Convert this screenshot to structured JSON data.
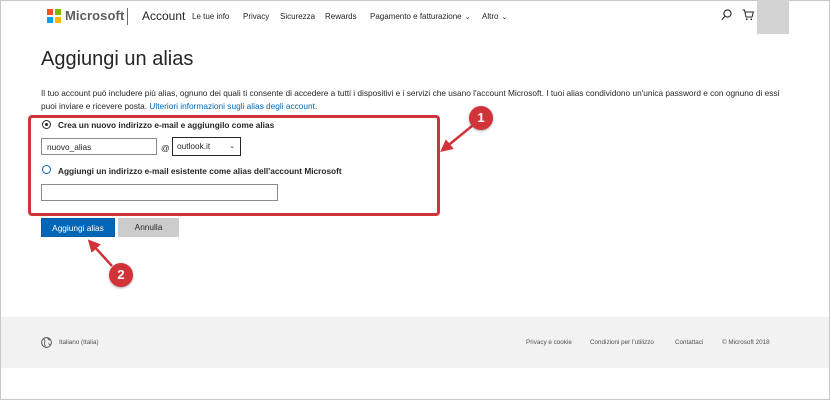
{
  "header": {
    "brand": "Microsoft",
    "section": "Account",
    "nav": [
      {
        "label": "Le tue info"
      },
      {
        "label": "Privacy"
      },
      {
        "label": "Sicurezza"
      },
      {
        "label": "Rewards"
      },
      {
        "label": "Pagamento e fatturazione"
      },
      {
        "label": "Altro"
      }
    ],
    "icons": [
      "search-icon",
      "cart-icon",
      "chevron-down-icon"
    ]
  },
  "page": {
    "title": "Aggiungi un alias",
    "description": "Il tuo account può includere più alias, ognuno dei quali ti consente di accedere a tutti i dispositivi e i servizi che usano l'account Microsoft. I tuoi alias condividono un'unica password e con ognuno di essi puoi inviare e ricevere posta. ",
    "learn_more_link": "Ulteriori informazioni sugli alias degli account."
  },
  "form": {
    "option_new_label": "Crea un nuovo indirizzo e-mail e aggiungilo come alias",
    "option_new_selected": true,
    "alias_value": "nuovo_alias",
    "at_symbol": "@",
    "domain_selected": "outlook.it",
    "option_existing_label": "Aggiungi un indirizzo e-mail esistente come alias dell'account Microsoft",
    "option_existing_selected": false,
    "existing_value": ""
  },
  "buttons": {
    "add_alias": "Aggiungi alias",
    "cancel": "Annulla"
  },
  "annotations": {
    "badge_1": "1",
    "badge_2": "2",
    "accent_color": "#d13438"
  },
  "footer": {
    "language": "Italiano (Italia)",
    "links": [
      {
        "label": "Privacy e cookie"
      },
      {
        "label": "Condizioni per l'utilizzo"
      },
      {
        "label": "Contattaci"
      }
    ],
    "copyright": "© Microsoft 2018"
  },
  "colors": {
    "link": "#0067b8",
    "primary_button": "#0067b8",
    "secondary_button": "#cccccc",
    "footer_bg": "#f2f2f2"
  }
}
